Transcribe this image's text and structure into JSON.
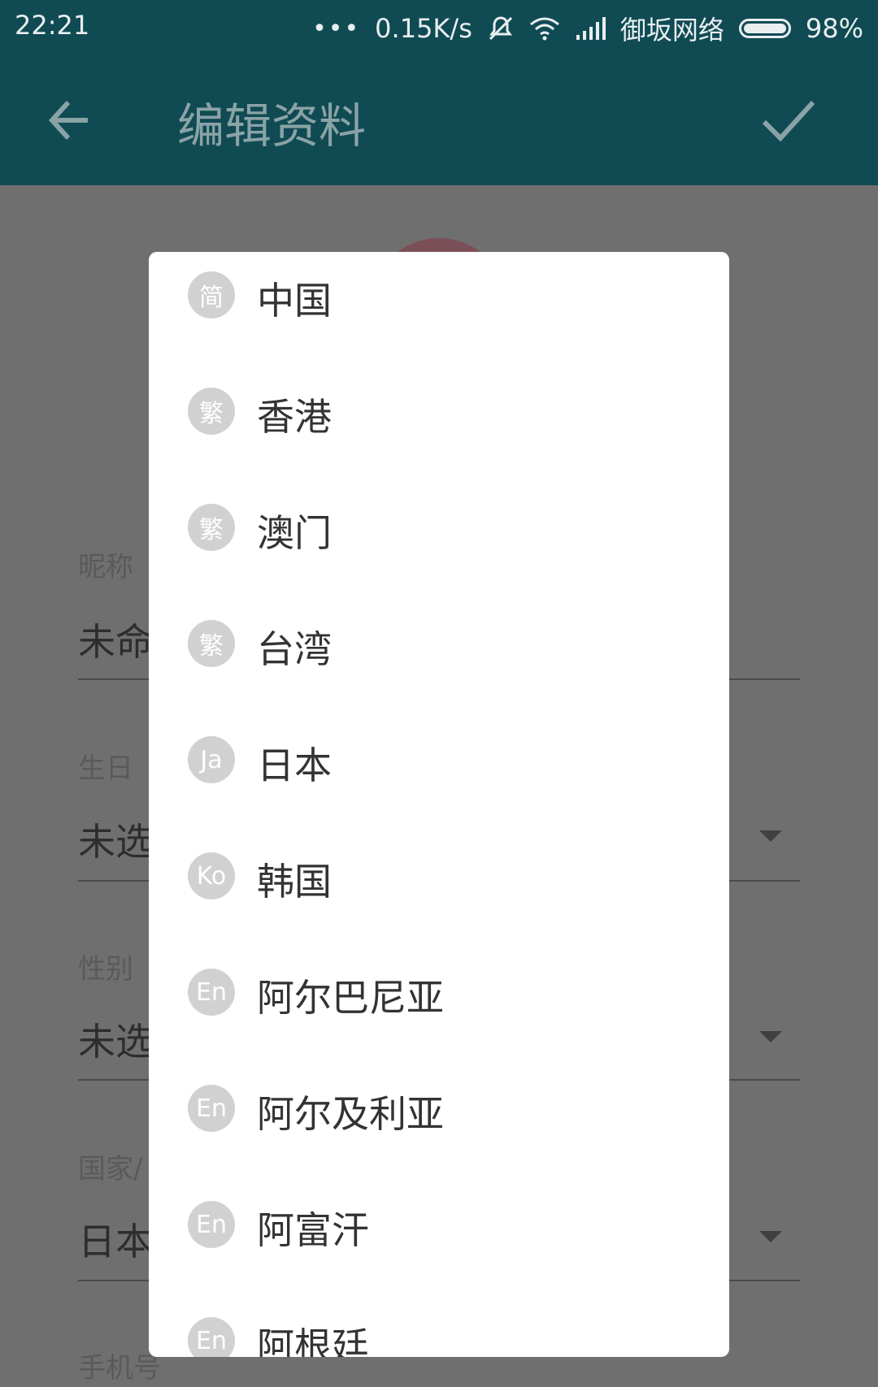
{
  "status_bar": {
    "time": "22:21",
    "more": "•••",
    "network_speed": "0.15K/s",
    "carrier": "御坂网络",
    "battery": "98%"
  },
  "toolbar": {
    "title": "编辑资料"
  },
  "form": {
    "nickname_label": "昵称",
    "nickname_value": "未命",
    "birthday_label": "生日",
    "birthday_value": "未选",
    "gender_label": "性别",
    "gender_value": "未选",
    "country_label": "国家/",
    "country_value": "日本",
    "phone_label": "手机号"
  },
  "dialog": {
    "items": [
      {
        "badge": "简",
        "label": "中国"
      },
      {
        "badge": "繁",
        "label": "香港"
      },
      {
        "badge": "繁",
        "label": "澳门"
      },
      {
        "badge": "繁",
        "label": "台湾"
      },
      {
        "badge": "Ja",
        "label": "日本"
      },
      {
        "badge": "Ko",
        "label": "韩国"
      },
      {
        "badge": "En",
        "label": "阿尔巴尼亚"
      },
      {
        "badge": "En",
        "label": "阿尔及利亚"
      },
      {
        "badge": "En",
        "label": "阿富汗"
      },
      {
        "badge": "En",
        "label": "阿根廷"
      }
    ]
  }
}
